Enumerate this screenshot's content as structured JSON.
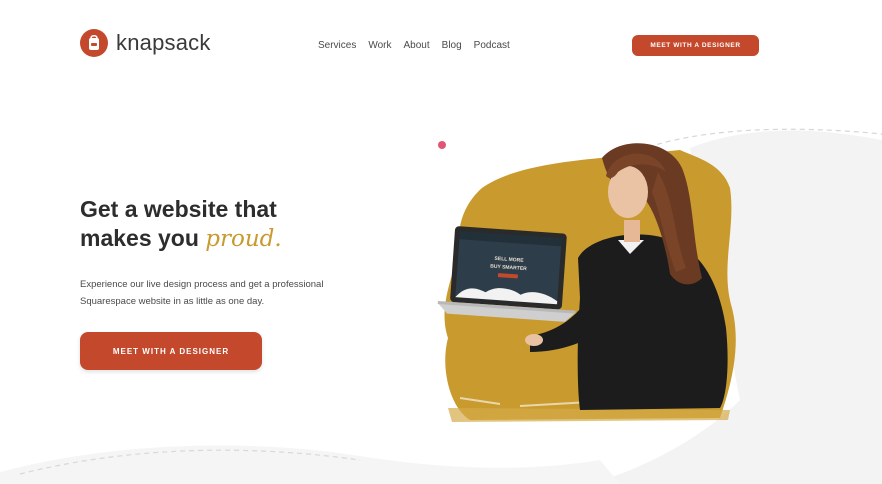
{
  "brand": {
    "name": "knapsack",
    "accent_color": "#c4492c",
    "gold_color": "#c99a2e"
  },
  "nav": {
    "items": [
      "Services",
      "Work",
      "About",
      "Blog",
      "Podcast"
    ]
  },
  "header": {
    "cta_label": "MEET WITH A DESIGNER"
  },
  "hero": {
    "headline_line1": "Get a website that",
    "headline_line2_prefix": "makes you ",
    "headline_accent": "proud.",
    "subtext_line1": "Experience our live design process and get a professional",
    "subtext_line2": "Squarespace website in as little as one day.",
    "cta_label": "MEET WITH A DESIGNER"
  },
  "laptop_screen": {
    "line1": "SELL MORE",
    "line2": "BUY SMARTER"
  },
  "icons": [
    "knapsack-logo-icon"
  ]
}
